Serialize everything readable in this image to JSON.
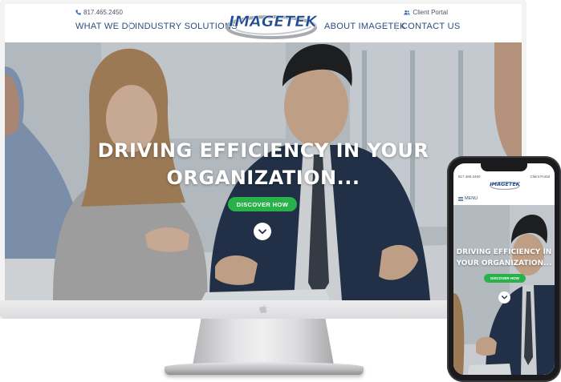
{
  "desktop": {
    "header": {
      "phone": "817.465.2450",
      "client_portal": "Client Portal",
      "nav_left": [
        "WHAT WE DO",
        "INDUSTRY SOLUTIONS"
      ],
      "nav_right": [
        "ABOUT IMAGETEK",
        "CONTACT US"
      ],
      "logo_text": "IMAGETEK"
    },
    "hero": {
      "headline_line1": "DRIVING EFFICIENCY IN YOUR",
      "headline_line2": "ORGANIZATION...",
      "cta": "DISCOVER HOW"
    }
  },
  "mobile": {
    "header": {
      "phone": "817.465.2450",
      "client_portal": "Client Portal",
      "logo_text": "IMAGETEK",
      "menu_label": "MENU"
    },
    "hero": {
      "headline_line1": "DRIVING EFFICIENCY IN",
      "headline_line2": "YOUR ORGANIZATION...",
      "cta": "DISCOVER HOW"
    }
  },
  "colors": {
    "nav_text": "#2e4c7a",
    "cta_green": "#2ab24a",
    "logo_blue": "#1f4e92",
    "headline": "#ffffff"
  },
  "icons": [
    "phone-icon",
    "user-icon",
    "chevron-down-icon",
    "hamburger-icon",
    "apple-logo-icon"
  ]
}
